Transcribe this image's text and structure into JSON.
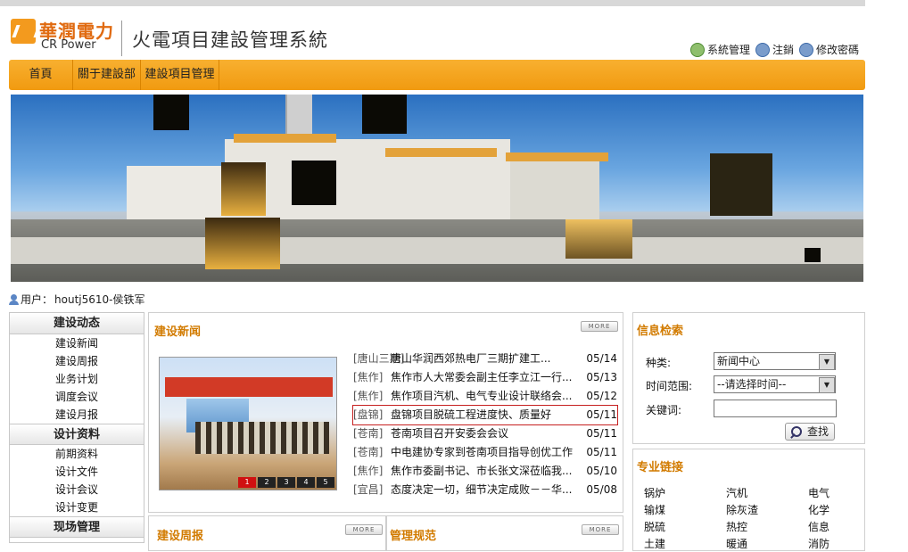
{
  "header": {
    "logo_cn": "華潤電力",
    "logo_en": "CR Power",
    "system_title": "火電項目建設管理系統",
    "links": [
      {
        "label": "系統管理",
        "icon": "gear-icon"
      },
      {
        "label": "注銷",
        "icon": "logout-icon"
      },
      {
        "label": "修改密碼",
        "icon": "password-icon"
      }
    ]
  },
  "nav": {
    "items": [
      "首頁",
      "關于建設部",
      "建設項目管理"
    ]
  },
  "user": {
    "label": "用户：",
    "name": "houtj5610-侯铁军"
  },
  "leftnav": {
    "sections": [
      {
        "title": "建设动态",
        "items": [
          "建设新闻",
          "建设周报",
          "业务计划",
          "调度会议",
          "建设月报"
        ]
      },
      {
        "title": "设计资料",
        "items": [
          "前期资料",
          "设计文件",
          "设计会议",
          "设计变更"
        ]
      },
      {
        "title": "现场管理",
        "items": []
      }
    ]
  },
  "news": {
    "title": "建设新闻",
    "more": "MORE",
    "image_pages": [
      "1",
      "2",
      "3",
      "4",
      "5"
    ],
    "items": [
      {
        "tag": "[唐山三期]",
        "title": "唐山华润西郊热电厂三期扩建工...",
        "date": "05/14"
      },
      {
        "tag": "[焦作]",
        "title": "焦作市人大常委会副主任李立江一行...",
        "date": "05/13"
      },
      {
        "tag": "[焦作]",
        "title": "焦作项目汽机、电气专业设计联络会...",
        "date": "05/12"
      },
      {
        "tag": "[盘锦]",
        "title": "盘锦项目脱硫工程进度快、质量好",
        "date": "05/11"
      },
      {
        "tag": "[苍南]",
        "title": "苍南项目召开安委会会议",
        "date": "05/11"
      },
      {
        "tag": "[苍南]",
        "title": "中电建协专家到苍南项目指导创优工作",
        "date": "05/11"
      },
      {
        "tag": "[焦作]",
        "title": "焦作市委副书记、市长张文深莅临我...",
        "date": "05/10"
      },
      {
        "tag": "[宜昌]",
        "title": "态度决定一切，细节决定成败－－华...",
        "date": "05/08"
      }
    ]
  },
  "weekly": {
    "title": "建设周报",
    "more": "MORE"
  },
  "rules": {
    "title": "管理规范",
    "more": "MORE"
  },
  "search": {
    "title": "信息检索",
    "type_label": "种类:",
    "type_value": "新闻中心",
    "time_label": "时间范围:",
    "time_value": "--请选择时间--",
    "keyword_label": "关键词:",
    "keyword_value": "",
    "button": "查找"
  },
  "links": {
    "title": "专业链接",
    "items": [
      "锅炉",
      "汽机",
      "电气",
      "输煤",
      "除灰渣",
      "化学",
      "脱硫",
      "热控",
      "信息",
      "土建",
      "暖通",
      "消防"
    ]
  },
  "colors": {
    "accent": "#f19a10",
    "title": "#d27b00",
    "highlight": "#c62020"
  }
}
